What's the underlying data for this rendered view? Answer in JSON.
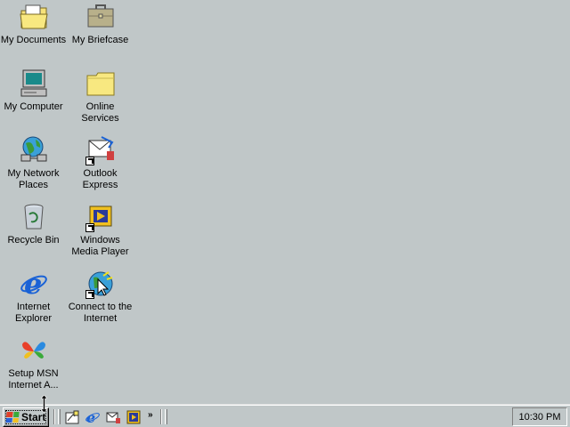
{
  "desktop": {
    "icons": [
      {
        "name": "my-documents",
        "label": "My Documents"
      },
      {
        "name": "my-briefcase",
        "label": "My Briefcase"
      },
      {
        "name": "my-computer",
        "label": "My Computer"
      },
      {
        "name": "online-services",
        "label": "Online\nServices"
      },
      {
        "name": "my-network-places",
        "label": "My Network\nPlaces"
      },
      {
        "name": "outlook-express",
        "label": "Outlook\nExpress"
      },
      {
        "name": "recycle-bin",
        "label": "Recycle Bin"
      },
      {
        "name": "windows-media-player",
        "label": "Windows\nMedia Player"
      },
      {
        "name": "internet-explorer",
        "label": "Internet\nExplorer"
      },
      {
        "name": "connect-to-internet",
        "label": "Connect to the\nInternet"
      },
      {
        "name": "setup-msn",
        "label": "Setup MSN\nInternet A..."
      }
    ]
  },
  "taskbar": {
    "start_label": "Start",
    "quicklaunch": [
      "show-desktop-icon",
      "internet-explorer-icon",
      "outlook-express-icon",
      "media-player-icon"
    ],
    "more_label": "»",
    "clock": "10:30 PM"
  },
  "colors": {
    "desktop_bg": "#c0c7c8",
    "folder": "#f8e880",
    "ie_blue": "#1a62d6"
  }
}
